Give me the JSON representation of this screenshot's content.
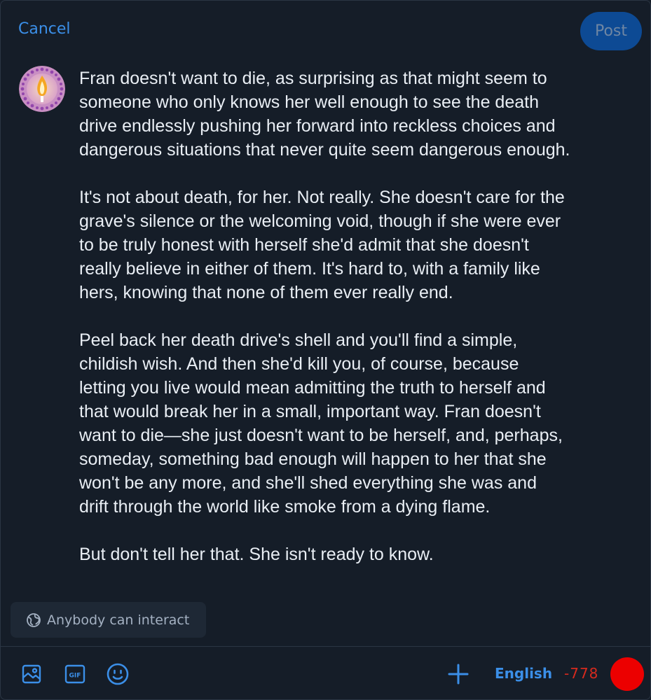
{
  "header": {
    "cancel_label": "Cancel",
    "post_label": "Post"
  },
  "composer": {
    "avatar_icon": "candle-flame-avatar",
    "text": "Fran doesn't want to die, as surprising as that might seem to\nsomeone who only knows her well enough to see the death\ndrive endlessly pushing her forward into reckless choices and\ndangerous situations that never quite seem dangerous enough.\n\nIt's not about death, for her. Not really. She doesn't care for the\ngrave's silence or the welcoming void, though if she were ever\nto be truly honest with herself she'd admit that she doesn't\nreally believe in either of them. It's hard to, with a family like\nhers, knowing that none of them ever really end.\n\nPeel back her death drive's shell and you'll find a simple,\nchildish wish. And then she'd kill you, of course, because\nletting you live would mean admitting the truth to herself and\nthat would break her in a small, important way. Fran doesn't\nwant to die—she just doesn't want to be herself, and, perhaps,\nsomeday, something bad enough will happen to her that she\nwon't be any more, and she'll shed everything she was and\ndrift through the world like smoke from a dying flame.\n\nBut don't tell her that. She isn't ready to know."
  },
  "interaction": {
    "label": "Anybody can interact",
    "icon": "globe-icon"
  },
  "toolbar": {
    "icons": [
      "image-icon",
      "gif-icon",
      "emoji-icon",
      "plus-icon"
    ],
    "gif_text": "GIF",
    "language": "English",
    "char_count": "-778"
  },
  "colors": {
    "background": "#151d28",
    "accent": "#3b8fe8",
    "post_button": "#0d4a94",
    "counter_over": "#d62a1e",
    "progress_dot": "#ec0000"
  }
}
